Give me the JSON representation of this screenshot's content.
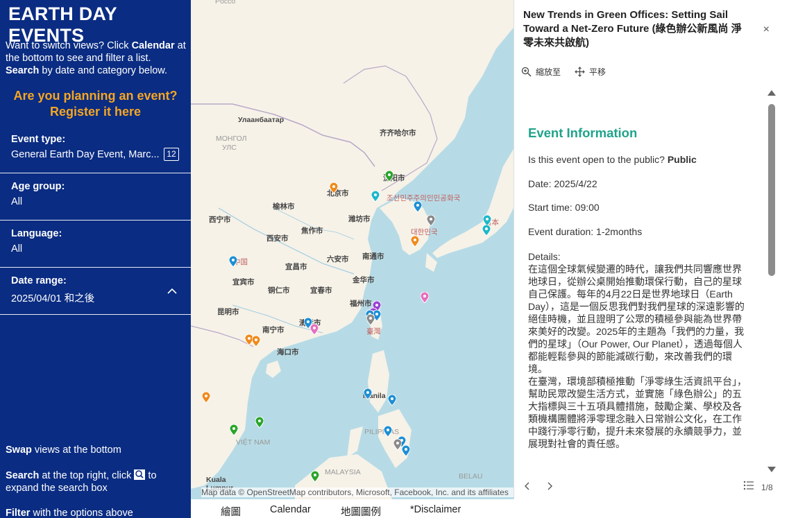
{
  "sidebar": {
    "title": "EARTH DAY EVENTS",
    "intro_a": "Want to switch views? Click ",
    "intro_b": "Calendar",
    "intro_c": " at the bottom to see and filter a list.",
    "intro_d": "Search",
    "intro_e": " by date and category below.",
    "cta_line1": "Are you planning an event?",
    "cta_line2": "Register it here",
    "filters": [
      {
        "label": "Event type:",
        "value": "General Earth Day Event, Marc...",
        "count": "12"
      },
      {
        "label": "Age group:",
        "value": "All"
      },
      {
        "label": "Language:",
        "value": "All"
      },
      {
        "label": "Date range:",
        "value": "2025/04/01 和之後"
      }
    ],
    "help": [
      {
        "bold": "Swap",
        "rest": " views at the bottom"
      },
      {
        "bold": "Search",
        "rest_a": " at the top right, click ",
        "rest_b": " to expand the search box"
      },
      {
        "bold": "Filter",
        "rest": " with the options above"
      }
    ]
  },
  "map": {
    "labels": [
      {
        "text": "Улаанбаатар",
        "cls": ""
      },
      {
        "text": "МОНГОЛ",
        "cls": "light"
      },
      {
        "text": "УЛС",
        "cls": "light"
      },
      {
        "text": "齐齐哈尔市",
        "cls": ""
      },
      {
        "text": "沈阳市",
        "cls": ""
      },
      {
        "text": "北京市",
        "cls": ""
      },
      {
        "text": "조선민주주의인민공화국",
        "cls": "red"
      },
      {
        "text": "榆林市",
        "cls": ""
      },
      {
        "text": "潍坊市",
        "cls": ""
      },
      {
        "text": "西宁市",
        "cls": ""
      },
      {
        "text": "焦作市",
        "cls": ""
      },
      {
        "text": "西安市",
        "cls": ""
      },
      {
        "text": "대한민국",
        "cls": "red"
      },
      {
        "text": "六安市",
        "cls": ""
      },
      {
        "text": "南通市",
        "cls": ""
      },
      {
        "text": "中国",
        "cls": "red"
      },
      {
        "text": "宜昌市",
        "cls": ""
      },
      {
        "text": "宜宾市",
        "cls": ""
      },
      {
        "text": "铜仁市",
        "cls": ""
      },
      {
        "text": "宜春市",
        "cls": ""
      },
      {
        "text": "金华市",
        "cls": ""
      },
      {
        "text": "福州市",
        "cls": ""
      },
      {
        "text": "昆明市",
        "cls": ""
      },
      {
        "text": "清远市",
        "cls": ""
      },
      {
        "text": "南宁市",
        "cls": ""
      },
      {
        "text": "海口市",
        "cls": ""
      },
      {
        "text": "臺灣",
        "cls": "red"
      },
      {
        "text": "Manila",
        "cls": ""
      },
      {
        "text": "PILIPINAS",
        "cls": "light"
      },
      {
        "text": "VIỆT NAM",
        "cls": "light"
      },
      {
        "text": "MALAYSIA",
        "cls": "light"
      },
      {
        "text": "BELAU",
        "cls": "light"
      },
      {
        "text": "Kuala",
        "cls": ""
      },
      {
        "text": "Lumpur",
        "cls": ""
      },
      {
        "text": "Pocco",
        "cls": "light"
      },
      {
        "text": "日本",
        "cls": "red"
      }
    ],
    "attribution": "Map data © OpenStreetMap contributors, Microsoft, Facebook, Inc. and its affiliates",
    "pin_colors": {
      "blue": "#1e8fd4",
      "orange": "#f08a1c",
      "green": "#2aa52a",
      "gray": "#8a8a8a",
      "purple": "#9b3fd6",
      "pink": "#e66fbf",
      "cyan": "#1fb7c9"
    }
  },
  "tabs": [
    "繪圖",
    "Calendar",
    "地圖圖例",
    "*Disclaimer"
  ],
  "panel": {
    "title": "New Trends in Green Offices: Setting Sail Toward a Net-Zero Future (綠色辦公新風尚 淨零未來共啟航)",
    "close_icon": "×",
    "zoom_label": "縮放至",
    "pan_label": "平移",
    "section_title": "Event Information",
    "public_q": "Is this event open to the public? ",
    "public_a": "Public",
    "date": "Date: 2025/4/22",
    "start": "Start time: 09:00",
    "duration": "Event duration: 1-2months",
    "details_label": "Details:",
    "details_p1": "在這個全球氣候變遷的時代，讓我們共同響應世界地球日，從辦公桌開始推動環保行動，自己的星球自己保護。每年的4月22日是世界地球日（Earth Day），這是一個反思我們對我們星球的深遠影響的絕佳時機，並且證明了公眾的積極參與能為世界帶來美好的改變。2025年的主題為「我們的力量，我們的星球」（Our Power, Our Planet），透過每個人都能輕鬆參與的節能減碳行動，來改善我們的環境。",
    "details_p2": "在臺灣，環境部積極推動「淨零綠生活資訊平台」，幫助民眾改變生活方式，並實施「綠色辦公」的五大指標與三十五項具體措施，鼓勵企業、學校及各類機構團體將淨零理念融入日常辦公文化，在工作中踐行淨零行動，提升未來發展的永續競爭力，並展現對社會的責任感。",
    "pager": "1/8"
  }
}
